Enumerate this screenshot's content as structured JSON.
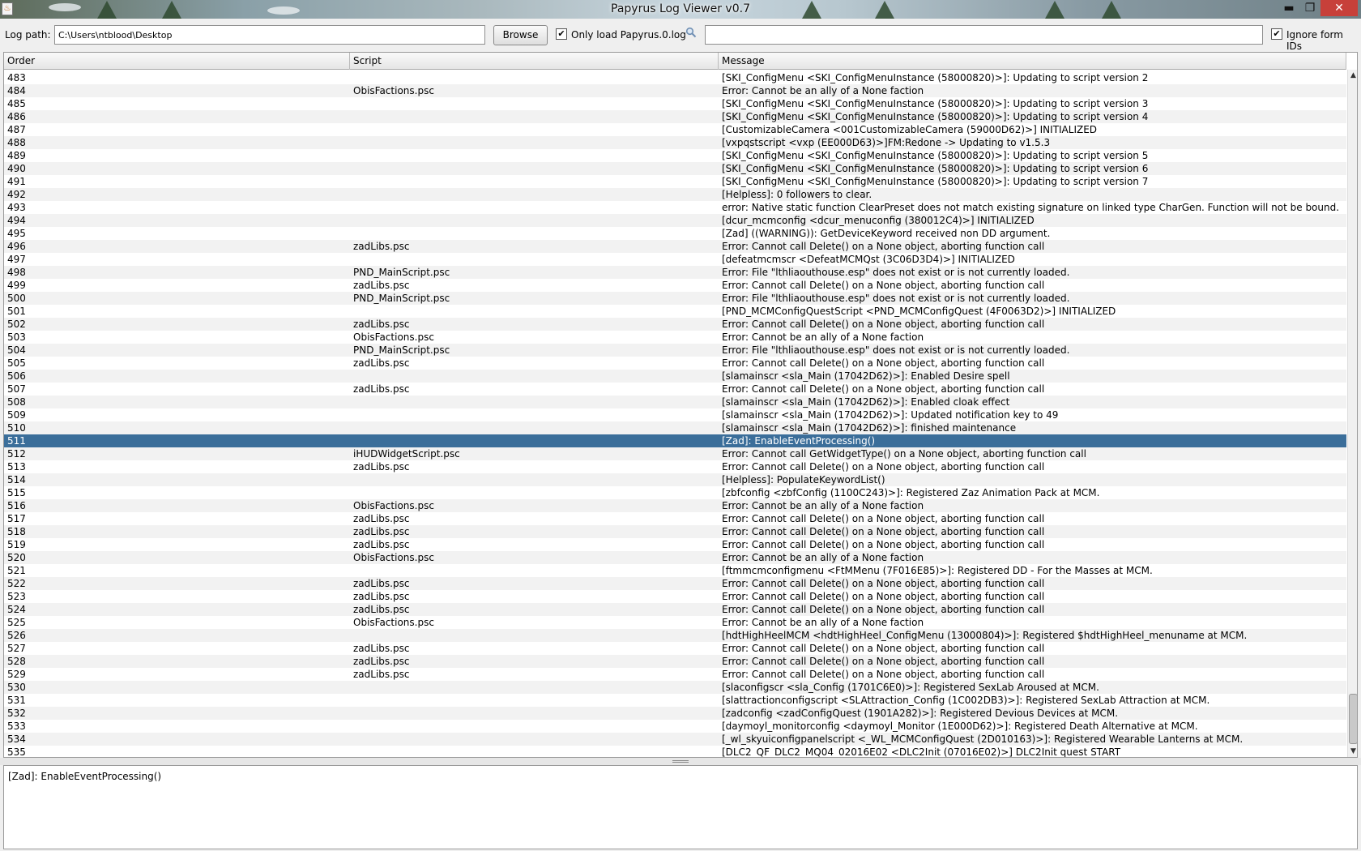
{
  "window": {
    "title": "Papyrus Log Viewer v0.7",
    "minimize": "▬",
    "maximize": "❐",
    "close": "✕"
  },
  "toolbar": {
    "log_path_label": "Log path:",
    "log_path_value": "C:\\Users\\ntblood\\Desktop",
    "browse_label": "Browse",
    "only_load_label": "Only load Papyrus.0.log",
    "only_load_checked": true,
    "search_value": "",
    "ignore_form_ids_label": "Ignore form IDs",
    "ignore_form_ids_checked": true
  },
  "table": {
    "columns": [
      "Order",
      "Script",
      "Message"
    ],
    "selected_order": "511",
    "rows": [
      [
        "483",
        "",
        "[SKI_ConfigMenu <SKI_ConfigMenuInstance (58000820)>]: Updating to script version 2"
      ],
      [
        "484",
        "ObisFactions.psc",
        "Error: Cannot be an ally of a None faction"
      ],
      [
        "485",
        "",
        "[SKI_ConfigMenu <SKI_ConfigMenuInstance (58000820)>]: Updating to script version 3"
      ],
      [
        "486",
        "",
        "[SKI_ConfigMenu <SKI_ConfigMenuInstance (58000820)>]: Updating to script version 4"
      ],
      [
        "487",
        "",
        "[CustomizableCamera <001CustomizableCamera (59000D62)>] INITIALIZED"
      ],
      [
        "488",
        "",
        "[vxpqstscript <vxp (EE000D63)>]FM:Redone -> Updating to v1.5.3"
      ],
      [
        "489",
        "",
        "[SKI_ConfigMenu <SKI_ConfigMenuInstance (58000820)>]: Updating to script version 5"
      ],
      [
        "490",
        "",
        "[SKI_ConfigMenu <SKI_ConfigMenuInstance (58000820)>]: Updating to script version 6"
      ],
      [
        "491",
        "",
        "[SKI_ConfigMenu <SKI_ConfigMenuInstance (58000820)>]: Updating to script version 7"
      ],
      [
        "492",
        "",
        "[Helpless]: 0 followers to clear."
      ],
      [
        "493",
        "",
        "error: Native static function ClearPreset does not match existing signature on linked type CharGen. Function will not be bound."
      ],
      [
        "494",
        "",
        "[dcur_mcmconfig <dcur_menuconfig (380012C4)>] INITIALIZED"
      ],
      [
        "495",
        "",
        "[Zad] ((WARNING)): GetDeviceKeyword received non DD argument."
      ],
      [
        "496",
        "zadLibs.psc",
        "Error: Cannot call Delete() on a None object, aborting function call"
      ],
      [
        "497",
        "",
        "[defeatmcmscr <DefeatMCMQst (3C06D3D4)>] INITIALIZED"
      ],
      [
        "498",
        "PND_MainScript.psc",
        "Error: File \"lthliaouthouse.esp\" does not exist or is not currently loaded."
      ],
      [
        "499",
        "zadLibs.psc",
        "Error: Cannot call Delete() on a None object, aborting function call"
      ],
      [
        "500",
        "PND_MainScript.psc",
        "Error: File \"lthliaouthouse.esp\" does not exist or is not currently loaded."
      ],
      [
        "501",
        "",
        "[PND_MCMConfigQuestScript <PND_MCMConfigQuest (4F0063D2)>] INITIALIZED"
      ],
      [
        "502",
        "zadLibs.psc",
        "Error: Cannot call Delete() on a None object, aborting function call"
      ],
      [
        "503",
        "ObisFactions.psc",
        "Error: Cannot be an ally of a None faction"
      ],
      [
        "504",
        "PND_MainScript.psc",
        "Error: File \"lthliaouthouse.esp\" does not exist or is not currently loaded."
      ],
      [
        "505",
        "zadLibs.psc",
        "Error: Cannot call Delete() on a None object, aborting function call"
      ],
      [
        "506",
        "",
        "[slamainscr <sla_Main (17042D62)>]: Enabled Desire spell"
      ],
      [
        "507",
        "zadLibs.psc",
        "Error: Cannot call Delete() on a None object, aborting function call"
      ],
      [
        "508",
        "",
        "[slamainscr <sla_Main (17042D62)>]: Enabled cloak effect"
      ],
      [
        "509",
        "",
        "[slamainscr <sla_Main (17042D62)>]: Updated notification key to 49"
      ],
      [
        "510",
        "",
        "[slamainscr <sla_Main (17042D62)>]: finished maintenance"
      ],
      [
        "511",
        "",
        "[Zad]: EnableEventProcessing()"
      ],
      [
        "512",
        "iHUDWidgetScript.psc",
        "Error: Cannot call GetWidgetType() on a None object, aborting function call"
      ],
      [
        "513",
        "zadLibs.psc",
        "Error: Cannot call Delete() on a None object, aborting function call"
      ],
      [
        "514",
        "",
        "[Helpless]: PopulateKeywordList()"
      ],
      [
        "515",
        "",
        "[zbfconfig <zbfConfig (1100C243)>]: Registered Zaz Animation Pack at MCM."
      ],
      [
        "516",
        "ObisFactions.psc",
        "Error: Cannot be an ally of a None faction"
      ],
      [
        "517",
        "zadLibs.psc",
        "Error: Cannot call Delete() on a None object, aborting function call"
      ],
      [
        "518",
        "zadLibs.psc",
        "Error: Cannot call Delete() on a None object, aborting function call"
      ],
      [
        "519",
        "zadLibs.psc",
        "Error: Cannot call Delete() on a None object, aborting function call"
      ],
      [
        "520",
        "ObisFactions.psc",
        "Error: Cannot be an ally of a None faction"
      ],
      [
        "521",
        "",
        "[ftmmcmconfigmenu <FtMMenu (7F016E85)>]: Registered DD - For the Masses at MCM."
      ],
      [
        "522",
        "zadLibs.psc",
        "Error: Cannot call Delete() on a None object, aborting function call"
      ],
      [
        "523",
        "zadLibs.psc",
        "Error: Cannot call Delete() on a None object, aborting function call"
      ],
      [
        "524",
        "zadLibs.psc",
        "Error: Cannot call Delete() on a None object, aborting function call"
      ],
      [
        "525",
        "ObisFactions.psc",
        "Error: Cannot be an ally of a None faction"
      ],
      [
        "526",
        "",
        "[hdtHighHeelMCM <hdtHighHeel_ConfigMenu (13000804)>]: Registered $hdtHighHeel_menuname at MCM."
      ],
      [
        "527",
        "zadLibs.psc",
        "Error: Cannot call Delete() on a None object, aborting function call"
      ],
      [
        "528",
        "zadLibs.psc",
        "Error: Cannot call Delete() on a None object, aborting function call"
      ],
      [
        "529",
        "zadLibs.psc",
        "Error: Cannot call Delete() on a None object, aborting function call"
      ],
      [
        "530",
        "",
        "[slaconfigscr <sla_Config (1701C6E0)>]: Registered SexLab Aroused at MCM."
      ],
      [
        "531",
        "",
        "[slattractionconfigscript <SLAttraction_Config (1C002DB3)>]: Registered SexLab Attraction at MCM."
      ],
      [
        "532",
        "",
        "[zadconfig <zadConfigQuest (1901A282)>]: Registered Devious Devices at MCM."
      ],
      [
        "533",
        "",
        "[daymoyl_monitorconfig <daymoyl_Monitor (1E000D62)>]: Registered Death Alternative at MCM."
      ],
      [
        "534",
        "",
        "[_wl_skyuiconfigpanelscript <_WL_MCMConfigQuest (2D010163)>]: Registered Wearable Lanterns at MCM."
      ],
      [
        "535",
        "",
        "[DLC2_QF_DLC2_MQ04_02016E02 <DLC2Init (07016E02)>] DLC2Init quest START"
      ]
    ]
  },
  "detail": {
    "text": "[Zad]: EnableEventProcessing()"
  }
}
